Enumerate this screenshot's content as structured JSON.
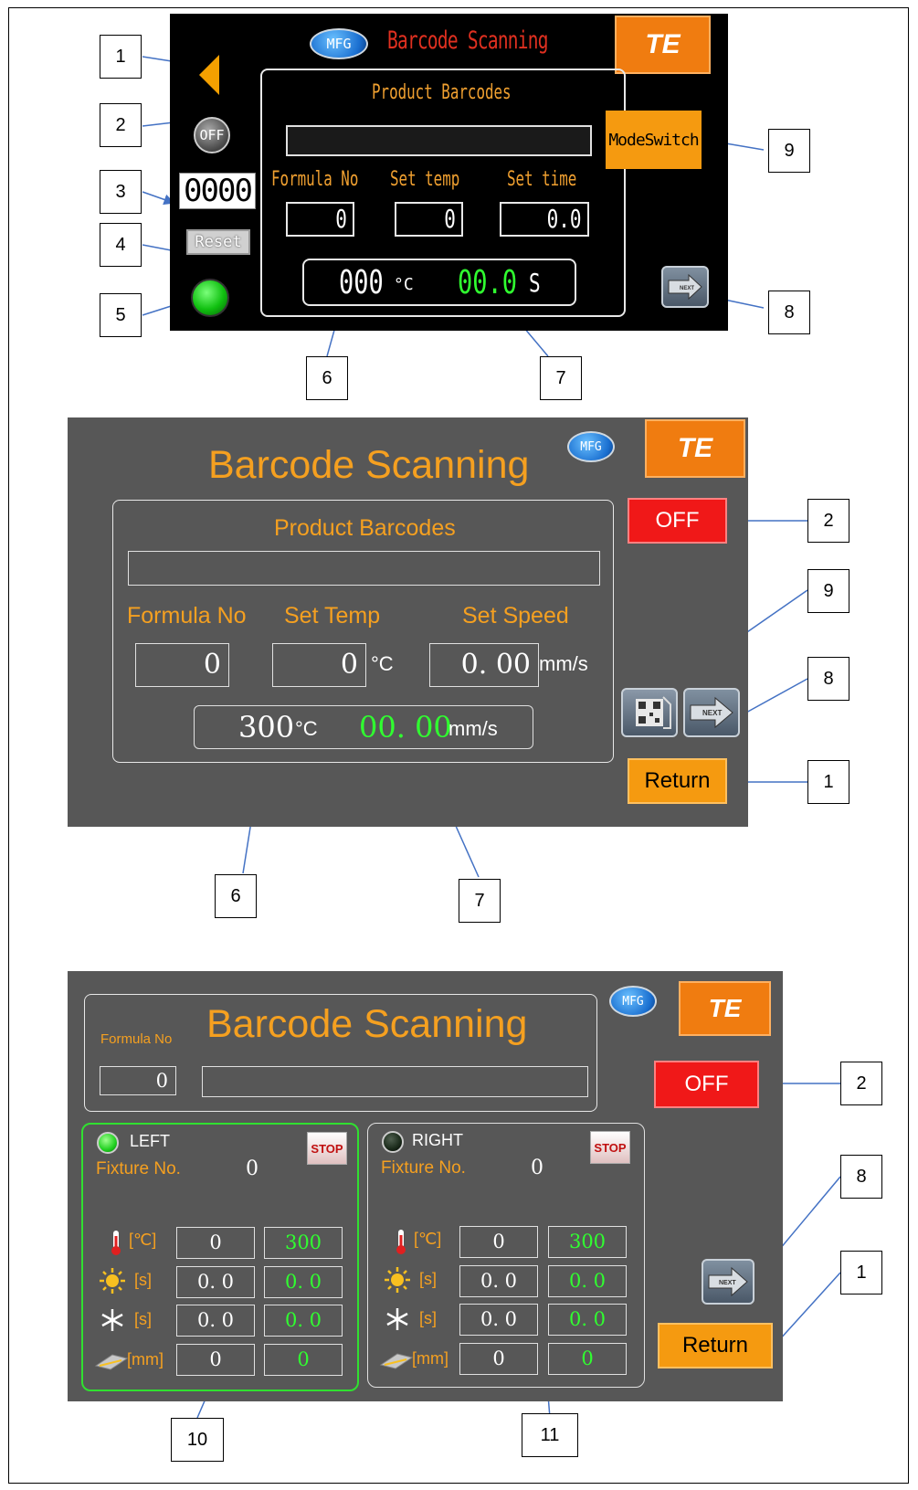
{
  "callouts": {
    "p1": [
      "1",
      "2",
      "3",
      "4",
      "5",
      "6",
      "7",
      "8",
      "9"
    ],
    "p2": [
      "2",
      "9",
      "8",
      "1",
      "6",
      "7"
    ],
    "p3": [
      "2",
      "8",
      "1",
      "10",
      "11"
    ]
  },
  "panel1": {
    "mfg": "MFG",
    "title": "Barcode Scanning",
    "logo": "TE",
    "section_title": "Product Barcodes",
    "barcode_value": "",
    "labels": {
      "formula": "Formula No",
      "set_temp": "Set temp",
      "set_time": "Set time"
    },
    "values": {
      "formula": "0",
      "set_temp": "0",
      "set_time": "0.0"
    },
    "readout": {
      "temp": "000",
      "temp_unit": "°C",
      "time": "00.0",
      "time_unit": "S"
    },
    "off_label": "OFF",
    "counter": "0000",
    "reset_label": "Reset",
    "modeswitch_label": "ModeSwitch",
    "next_label": "NEXT"
  },
  "panel2": {
    "mfg": "MFG",
    "title": "Barcode Scanning",
    "logo": "TE",
    "section_title": "Product Barcodes",
    "barcode_value": "",
    "labels": {
      "formula": "Formula No",
      "set_temp": "Set Temp",
      "set_speed": "Set Speed"
    },
    "values": {
      "formula": "0",
      "set_temp": "0",
      "set_speed": "0. 00"
    },
    "units": {
      "temp": "°C",
      "speed": "mm/s"
    },
    "readout": {
      "temp": "300",
      "temp_unit": "°C",
      "speed": "00. 00",
      "speed_unit": "mm/s"
    },
    "off_label": "OFF",
    "return_label": "Return",
    "next_label": "NEXT"
  },
  "panel3": {
    "mfg": "MFG",
    "title": "Barcode Scanning",
    "logo": "TE",
    "formula_label": "Formula No",
    "formula_value": "0",
    "barcode_value": "",
    "off_label": "OFF",
    "return_label": "Return",
    "next_label": "NEXT",
    "left": {
      "title": "LEFT",
      "stop": "STOP",
      "fixture_label": "Fixture No.",
      "fixture_value": "0",
      "rows": [
        {
          "unit": "[℃]",
          "set": "0",
          "act": "300"
        },
        {
          "unit": "[s]",
          "set": "0. 0",
          "act": "0. 0"
        },
        {
          "unit": "[s]",
          "set": "0. 0",
          "act": "0. 0"
        },
        {
          "unit": "[mm]",
          "set": "0",
          "act": "0"
        }
      ]
    },
    "right": {
      "title": "RIGHT",
      "stop": "STOP",
      "fixture_label": "Fixture No.",
      "fixture_value": "0",
      "rows": [
        {
          "unit": "[℃]",
          "set": "0",
          "act": "300"
        },
        {
          "unit": "[s]",
          "set": "0. 0",
          "act": "0. 0"
        },
        {
          "unit": "[s]",
          "set": "0. 0",
          "act": "0. 0"
        },
        {
          "unit": "[mm]",
          "set": "0",
          "act": "0"
        }
      ]
    }
  },
  "colors": {
    "accent_orange": "#f5a020",
    "alarm_red": "#f01818",
    "ok_green": "#30ff30",
    "panel_gray": "#575757"
  }
}
